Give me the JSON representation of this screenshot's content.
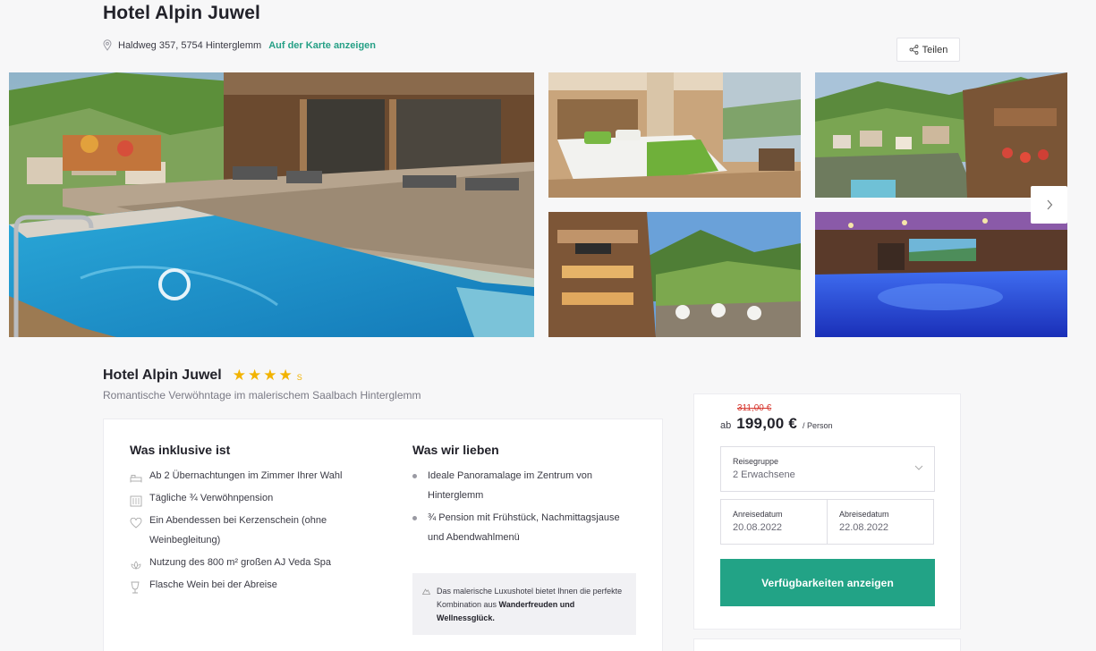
{
  "header": {
    "title": "Hotel Alpin Juwel",
    "address": "Haldweg 357, 5754 Hinterglemm",
    "map_link": "Auf der Karte anzeigen",
    "share_label": "Teilen"
  },
  "gallery": {
    "images": [
      "outdoor-pool-terrace",
      "hotel-room",
      "village-view",
      "chalet-exterior",
      "indoor-spa-pool"
    ]
  },
  "detail": {
    "title": "Hotel Alpin Juwel",
    "stars": 4,
    "star_suffix": "S",
    "subtitle": "Romantische Verwöhntage im malerischem Saalbach Hinterglemm"
  },
  "included": {
    "title": "Was inklusive ist",
    "items": [
      {
        "icon": "bed-icon",
        "text": "Ab 2 Übernachtungen im Zimmer Ihrer Wahl"
      },
      {
        "icon": "meal-icon",
        "text": "Tägliche ¾ Verwöhnpension"
      },
      {
        "icon": "heart-icon",
        "text": "Ein Abendessen bei Kerzenschein (ohne Weinbegleitung)"
      },
      {
        "icon": "spa-icon",
        "text": "Nutzung des 800 m² großen AJ Veda Spa"
      },
      {
        "icon": "wine-glass-icon",
        "text": "Flasche Wein bei der Abreise"
      }
    ]
  },
  "love": {
    "title": "Was wir lieben",
    "items": [
      "Ideale Panoramalage im Zentrum von Hinterglemm",
      "¾ Pension mit Frühstück, Nachmittagsjause und Abendwahlmenü"
    ],
    "hint_pre": "Das malerische Luxushotel bietet Ihnen die perfekte Kombination aus ",
    "hint_bold": "Wanderfreuden und Wellnessglück."
  },
  "booking": {
    "old_price": "311,00 €",
    "price_prefix": "ab",
    "price": "199,00 €",
    "price_unit": "/ Person",
    "group_label": "Reisegruppe",
    "group_value": "2 Erwachsene",
    "arrival_label": "Anreisedatum",
    "arrival_value": "20.08.2022",
    "departure_label": "Abreisedatum",
    "departure_value": "22.08.2022",
    "cta_label": "Verfügbarkeiten anzeigen"
  },
  "colors": {
    "accent": "#22a386",
    "star": "#f2b300",
    "old_price": "#d6342c"
  }
}
